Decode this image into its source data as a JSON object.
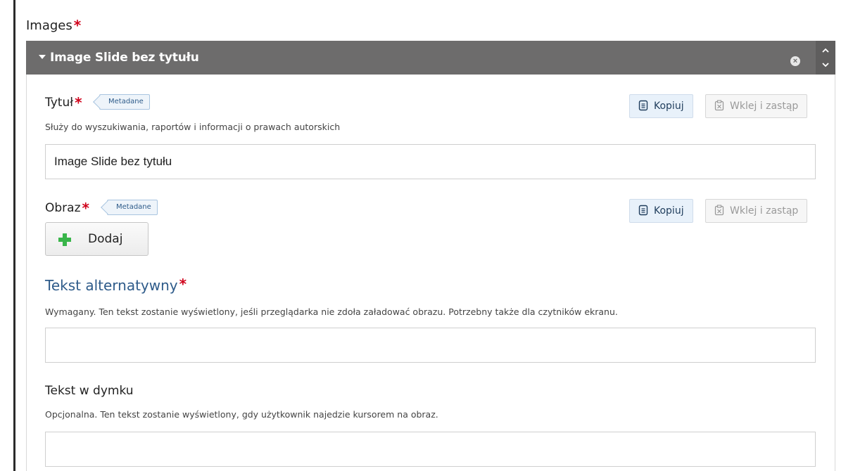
{
  "images_label": "Images",
  "required_mark": "*",
  "slide": {
    "header_title": "Image Slide bez tytułu"
  },
  "fields": {
    "title": {
      "label": "Tytuł",
      "tag": "Metadane",
      "description": "Służy do wyszukiwania, raportów i informacji o prawach autorskich",
      "value": "Image Slide bez tytułu"
    },
    "image": {
      "label": "Obraz",
      "tag": "Metadane",
      "add_label": "Dodaj"
    },
    "alt_text": {
      "label": "Tekst alternatywny",
      "description": "Wymagany. Ten tekst zostanie wyświetlony, jeśli przeglądarka nie zdoła załadować obrazu. Potrzebny także dla czytników ekranu.",
      "value": ""
    },
    "hover_text": {
      "label": "Tekst w dymku",
      "description": "Opcjonalna. Ten tekst zostanie wyświetlony, gdy użytkownik najedzie kursorem na obraz.",
      "value": ""
    }
  },
  "buttons": {
    "copy_label": "Kopiuj",
    "paste_label": "Wklej i zastąp"
  },
  "colors": {
    "header_bg": "#6d6c6c",
    "required": "#d0021b",
    "link_blue": "#2e5b8a",
    "add_green": "#39b54a"
  }
}
